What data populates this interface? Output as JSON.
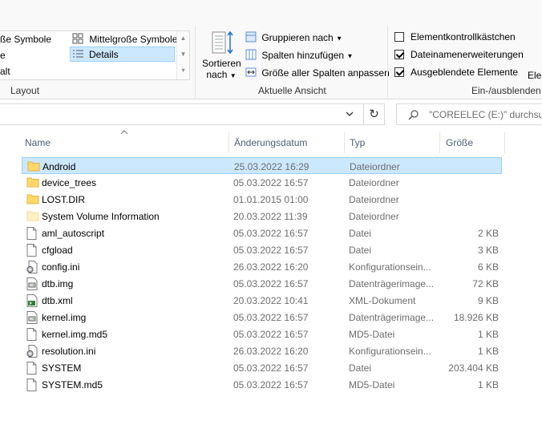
{
  "ribbon": {
    "layout": {
      "items_left": [
        "ße Symbole",
        "e",
        "alt"
      ],
      "medium_icons": "Mittelgroße Symbole",
      "details": "Details",
      "group_label": "Layout"
    },
    "current_view": {
      "sort_line1": "Sortieren",
      "sort_line2": "nach",
      "group_by": "Gruppieren nach",
      "add_columns": "Spalten hinzufügen",
      "fit_columns": "Größe aller Spalten anpassen",
      "group_label": "Aktuelle Ansicht"
    },
    "show_hide": {
      "item_checkboxes": {
        "label": "Elementkontrollkästchen",
        "checked": false
      },
      "file_extensions": {
        "label": "Dateinamenerweiterungen",
        "checked": true
      },
      "hidden_items": {
        "label": "Ausgeblendete Elemente",
        "checked": true
      },
      "group_label": "Ein-/ausblenden",
      "cut_off_label": "Elen"
    }
  },
  "search": {
    "placeholder": "\"COREELEC (E:)\" durchsuchen"
  },
  "columns": {
    "name": "Name",
    "date": "Änderungsdatum",
    "type": "Typ",
    "size": "Größe"
  },
  "files": [
    {
      "name": "Android",
      "date": "25.03.2022 16:29",
      "type": "Dateiordner",
      "size": "",
      "icon": "folder-icon",
      "selected": true
    },
    {
      "name": "device_trees",
      "date": "05.03.2022 16:57",
      "type": "Dateiordner",
      "size": "",
      "icon": "folder-icon"
    },
    {
      "name": "LOST.DIR",
      "date": "01.01.2015 01:00",
      "type": "Dateiordner",
      "size": "",
      "icon": "folder-icon"
    },
    {
      "name": "System Volume Information",
      "date": "20.03.2022 11:39",
      "type": "Dateiordner",
      "size": "",
      "icon": "hidden-folder-icon"
    },
    {
      "name": "aml_autoscript",
      "date": "05.03.2022 16:57",
      "type": "Datei",
      "size": "2 KB",
      "icon": "file-icon"
    },
    {
      "name": "cfgload",
      "date": "05.03.2022 16:57",
      "type": "Datei",
      "size": "3 KB",
      "icon": "file-icon"
    },
    {
      "name": "config.ini",
      "date": "26.03.2022 16:20",
      "type": "Konfigurationsein...",
      "size": "6 KB",
      "icon": "settings-file-icon"
    },
    {
      "name": "dtb.img",
      "date": "05.03.2022 16:57",
      "type": "Datenträgerimage...",
      "size": "72 KB",
      "icon": "disk-image-icon"
    },
    {
      "name": "dtb.xml",
      "date": "20.03.2022 10:41",
      "type": "XML-Dokument",
      "size": "9 KB",
      "icon": "xml-file-icon"
    },
    {
      "name": "kernel.img",
      "date": "05.03.2022 16:57",
      "type": "Datenträgerimage...",
      "size": "18.926 KB",
      "icon": "disk-image-icon"
    },
    {
      "name": "kernel.img.md5",
      "date": "05.03.2022 16:57",
      "type": "MD5-Datei",
      "size": "1 KB",
      "icon": "file-icon"
    },
    {
      "name": "resolution.ini",
      "date": "26.03.2022 16:20",
      "type": "Konfigurationsein...",
      "size": "1 KB",
      "icon": "settings-file-icon"
    },
    {
      "name": "SYSTEM",
      "date": "05.03.2022 16:57",
      "type": "Datei",
      "size": "203.404 KB",
      "icon": "file-icon"
    },
    {
      "name": "SYSTEM.md5",
      "date": "05.03.2022 16:57",
      "type": "MD5-Datei",
      "size": "1 KB",
      "icon": "file-icon"
    }
  ],
  "colors": {
    "selection_bg": "#cce8ff",
    "selection_border": "#99d1ff",
    "folder": "#ffd86a",
    "column_header": "#4c607a"
  }
}
